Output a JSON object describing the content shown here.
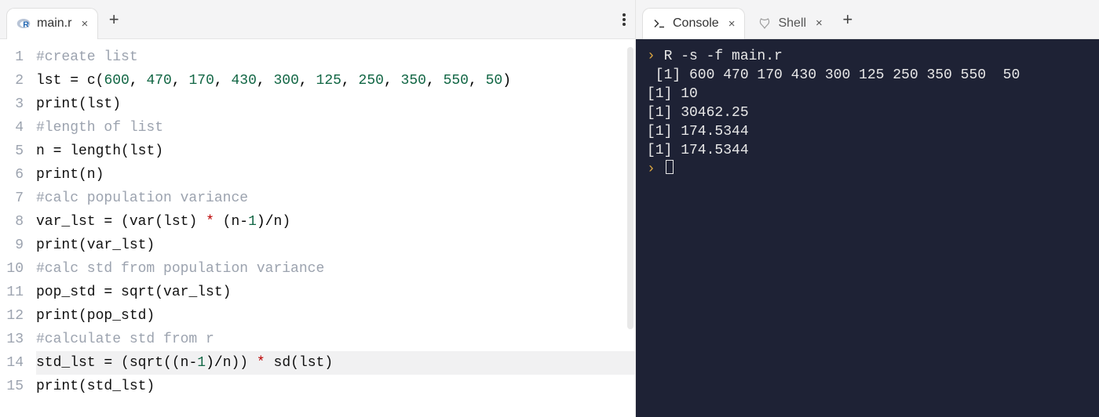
{
  "editor": {
    "tabs": [
      {
        "label": "main.r",
        "active": true,
        "icon": "r-lang-icon"
      }
    ],
    "code_lines": [
      {
        "n": 1,
        "tokens": [
          {
            "t": "#create list",
            "c": "c-comment"
          }
        ]
      },
      {
        "n": 2,
        "tokens": [
          {
            "t": "lst ",
            "c": "c-id"
          },
          {
            "t": "=",
            "c": "c-op"
          },
          {
            "t": " c(",
            "c": "c-id"
          },
          {
            "t": "600",
            "c": "c-num"
          },
          {
            "t": ", ",
            "c": "c-op"
          },
          {
            "t": "470",
            "c": "c-num"
          },
          {
            "t": ", ",
            "c": "c-op"
          },
          {
            "t": "170",
            "c": "c-num"
          },
          {
            "t": ", ",
            "c": "c-op"
          },
          {
            "t": "430",
            "c": "c-num"
          },
          {
            "t": ", ",
            "c": "c-op"
          },
          {
            "t": "300",
            "c": "c-num"
          },
          {
            "t": ", ",
            "c": "c-op"
          },
          {
            "t": "125",
            "c": "c-num"
          },
          {
            "t": ", ",
            "c": "c-op"
          },
          {
            "t": "250",
            "c": "c-num"
          },
          {
            "t": ", ",
            "c": "c-op"
          },
          {
            "t": "350",
            "c": "c-num"
          },
          {
            "t": ", ",
            "c": "c-op"
          },
          {
            "t": "550",
            "c": "c-num"
          },
          {
            "t": ", ",
            "c": "c-op"
          },
          {
            "t": "50",
            "c": "c-num"
          },
          {
            "t": ")",
            "c": "c-op"
          }
        ]
      },
      {
        "n": 3,
        "tokens": [
          {
            "t": "print(lst)",
            "c": "c-id"
          }
        ]
      },
      {
        "n": 4,
        "tokens": [
          {
            "t": "#length of list",
            "c": "c-comment"
          }
        ]
      },
      {
        "n": 5,
        "tokens": [
          {
            "t": "n ",
            "c": "c-id"
          },
          {
            "t": "=",
            "c": "c-op"
          },
          {
            "t": " length(lst)",
            "c": "c-id"
          }
        ]
      },
      {
        "n": 6,
        "tokens": [
          {
            "t": "print(n)",
            "c": "c-id"
          }
        ]
      },
      {
        "n": 7,
        "tokens": [
          {
            "t": "#calc population variance",
            "c": "c-comment"
          }
        ]
      },
      {
        "n": 8,
        "tokens": [
          {
            "t": "var_lst ",
            "c": "c-id"
          },
          {
            "t": "=",
            "c": "c-op"
          },
          {
            "t": " (var(lst) ",
            "c": "c-id"
          },
          {
            "t": "*",
            "c": "c-star"
          },
          {
            "t": " (n",
            "c": "c-id"
          },
          {
            "t": "-",
            "c": "c-op"
          },
          {
            "t": "1",
            "c": "c-num"
          },
          {
            "t": ")",
            "c": "c-op"
          },
          {
            "t": "/",
            "c": "c-op"
          },
          {
            "t": "n)",
            "c": "c-id"
          }
        ]
      },
      {
        "n": 9,
        "tokens": [
          {
            "t": "print(var_lst)",
            "c": "c-id"
          }
        ]
      },
      {
        "n": 10,
        "tokens": [
          {
            "t": "#calc std from population variance",
            "c": "c-comment"
          }
        ]
      },
      {
        "n": 11,
        "tokens": [
          {
            "t": "pop_std ",
            "c": "c-id"
          },
          {
            "t": "=",
            "c": "c-op"
          },
          {
            "t": " sqrt(var_lst)",
            "c": "c-id"
          }
        ]
      },
      {
        "n": 12,
        "tokens": [
          {
            "t": "print(pop_std)",
            "c": "c-id"
          }
        ]
      },
      {
        "n": 13,
        "tokens": [
          {
            "t": "#calculate std from r",
            "c": "c-comment"
          }
        ]
      },
      {
        "n": 14,
        "current": true,
        "tokens": [
          {
            "t": "std_lst ",
            "c": "c-id"
          },
          {
            "t": "=",
            "c": "c-op"
          },
          {
            "t": " (sqrt((n",
            "c": "c-id"
          },
          {
            "t": "-",
            "c": "c-op"
          },
          {
            "t": "1",
            "c": "c-num"
          },
          {
            "t": ")",
            "c": "c-op"
          },
          {
            "t": "/",
            "c": "c-op"
          },
          {
            "t": "n)) ",
            "c": "c-id"
          },
          {
            "t": "*",
            "c": "c-star"
          },
          {
            "t": " sd(lst)",
            "c": "c-id"
          }
        ]
      },
      {
        "n": 15,
        "tokens": [
          {
            "t": "print(std_lst)",
            "c": "c-id"
          }
        ]
      }
    ]
  },
  "terminal": {
    "tabs": [
      {
        "label": "Console",
        "active": true,
        "icon": "console-icon"
      },
      {
        "label": "Shell",
        "active": false,
        "icon": "shell-icon"
      }
    ],
    "lines": [
      {
        "prompt": true,
        "text": "R -s -f main.r"
      },
      {
        "text": " [1] 600 470 170 430 300 125 250 350 550  50"
      },
      {
        "text": "[1] 10"
      },
      {
        "text": "[1] 30462.25"
      },
      {
        "text": "[1] 174.5344"
      },
      {
        "text": "[1] 174.5344"
      },
      {
        "prompt": true,
        "cursor": true,
        "text": ""
      }
    ]
  },
  "glyphs": {
    "close": "×",
    "plus": "+",
    "prompt": "›"
  }
}
